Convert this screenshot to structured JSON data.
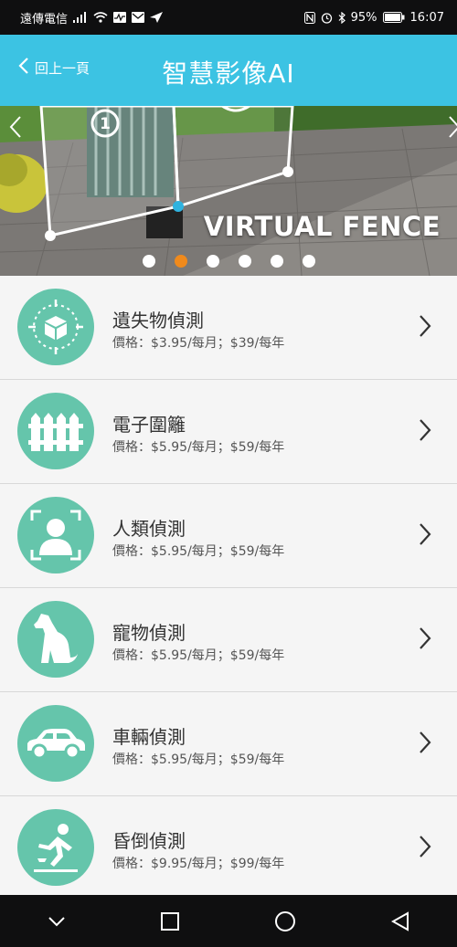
{
  "status_bar": {
    "carrier": "遠傳電信",
    "battery": "95%",
    "time": "16:07"
  },
  "header": {
    "back_label": "回上一頁",
    "title": "智慧影像AI"
  },
  "banner": {
    "caption": "VIRTUAL FENCE",
    "slide_count": 6,
    "active_slide": 2
  },
  "features": [
    {
      "name": "遺失物偵測",
      "price": "價格：$3.95/每月；$39/每年",
      "icon": "lost-item-icon"
    },
    {
      "name": "電子圍籬",
      "price": "價格：$5.95/每月；$59/每年",
      "icon": "fence-icon"
    },
    {
      "name": "人類偵測",
      "price": "價格：$5.95/每月；$59/每年",
      "icon": "person-detection-icon"
    },
    {
      "name": "寵物偵測",
      "price": "價格：$5.95/每月；$59/每年",
      "icon": "dog-icon"
    },
    {
      "name": "車輛偵測",
      "price": "價格：$5.95/每月；$59/每年",
      "icon": "car-icon"
    },
    {
      "name": "昏倒偵測",
      "price": "價格：$9.95/每月；$99/每年",
      "icon": "fall-icon"
    }
  ],
  "colors": {
    "header_bg": "#3cc3e3",
    "icon_circle": "#65c5ab",
    "active_dot": "#f08a1c"
  }
}
